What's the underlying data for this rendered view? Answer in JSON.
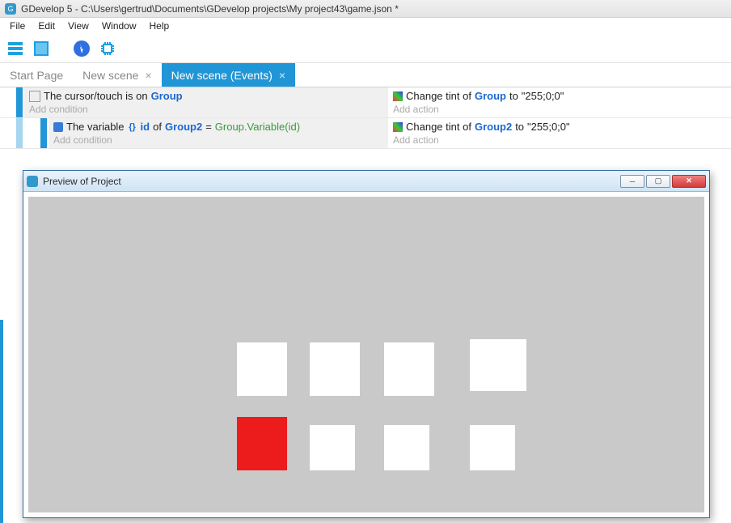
{
  "window": {
    "title": "GDevelop 5 - C:\\Users\\gertrud\\Documents\\GDevelop projects\\My project43\\game.json *"
  },
  "menu": {
    "file": "File",
    "edit": "Edit",
    "view": "View",
    "window": "Window",
    "help": "Help"
  },
  "tabs": {
    "start": "Start Page",
    "scene": "New scene",
    "events": "New scene (Events)",
    "close_glyph": "×"
  },
  "events": {
    "row1": {
      "cond_prefix": "The cursor/touch is on ",
      "cond_obj": "Group",
      "add_cond": "Add condition",
      "action_prefix": "Change tint of ",
      "action_obj": "Group",
      "action_mid": " to ",
      "action_value": "\"255;0;0\"",
      "add_action": "Add action"
    },
    "row2": {
      "cond_prefix": "The variable ",
      "cond_var": "id",
      "cond_mid1": " of ",
      "cond_obj": "Group2",
      "cond_eq": " = ",
      "cond_expr": "Group.Variable(id)",
      "add_cond": "Add condition",
      "action_prefix": "Change tint of ",
      "action_obj": "Group2",
      "action_mid": " to ",
      "action_value": "\"255;0;0\"",
      "add_action": "Add action"
    }
  },
  "preview": {
    "title": "Preview of Project",
    "btn_min": "__",
    "btn_max": "❐",
    "btn_close": "✕"
  }
}
